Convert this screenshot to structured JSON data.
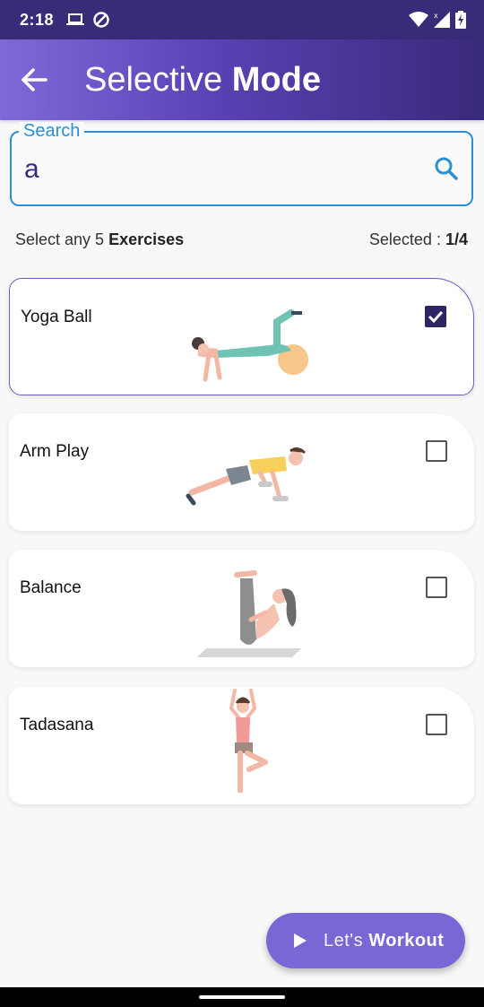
{
  "status_bar": {
    "time": "2:18"
  },
  "app_bar": {
    "title_light": "Selective",
    "title_bold": "Mode"
  },
  "search": {
    "label": "Search",
    "value": "a",
    "placeholder": ""
  },
  "info": {
    "select_prefix": "Select any 5",
    "select_suffix": "Exercises",
    "selected_prefix": "Selected :",
    "selected_count": "1/4"
  },
  "exercises": [
    {
      "name": "Yoga Ball",
      "checked": true
    },
    {
      "name": "Arm Play",
      "checked": false
    },
    {
      "name": "Balance",
      "checked": false
    },
    {
      "name": "Tadasana",
      "checked": false
    }
  ],
  "fab": {
    "label_light": "Let's",
    "label_bold": "Workout"
  },
  "colors": {
    "accent": "#7b66d6",
    "search_border": "#2b8fd3",
    "checkbox_checked": "#2f2466"
  }
}
